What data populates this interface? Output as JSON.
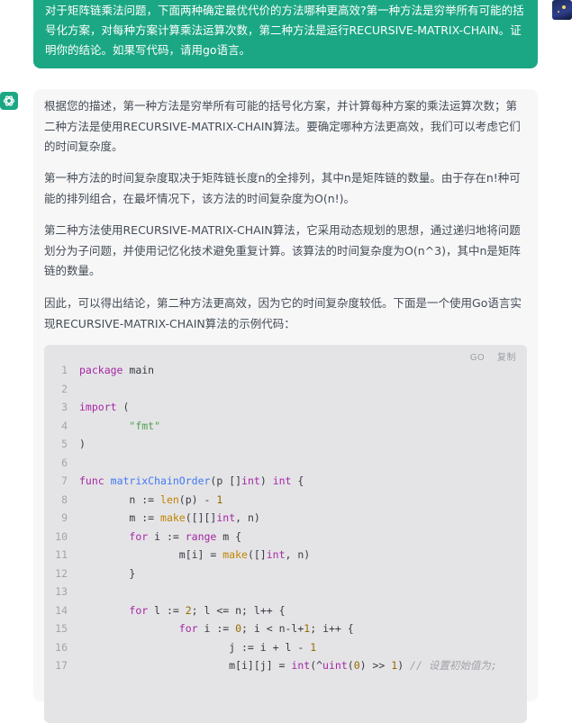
{
  "user_message": {
    "text": "对于矩阵链乘法问题，下面两种确定最优代价的方法哪种更高效?第一种方法是穷举所有可能的括号化方案，对每种方案计算乘法运算次数，第二种方法是运行RECURSIVE-MATRIX-CHAIN。证明你的结论。如果写代码，请用go语言。"
  },
  "assistant_message": {
    "paragraphs": [
      "根据您的描述，第一种方法是穷举所有可能的括号化方案，并计算每种方案的乘法运算次数；第二种方法是使用RECURSIVE-MATRIX-CHAIN算法。要确定哪种方法更高效，我们可以考虑它们的时间复杂度。",
      "第一种方法的时间复杂度取决于矩阵链长度n的全排列，其中n是矩阵链的数量。由于存在n!种可能的排列组合，在最坏情况下，该方法的时间复杂度为O(n!)。",
      "第二种方法使用RECURSIVE-MATRIX-CHAIN算法，它采用动态规划的思想，通过递归地将问题划分为子问题，并使用记忆化技术避免重复计算。该算法的时间复杂度为O(n^3)，其中n是矩阵链的数量。",
      "因此，可以得出结论，第二种方法更高效，因为它的时间复杂度较低。下面是一个使用Go语言实现RECURSIVE-MATRIX-CHAIN算法的示例代码："
    ]
  },
  "code_block": {
    "language": "GO",
    "copy_label": "复制",
    "lines": [
      {
        "n": "1",
        "text": "package main"
      },
      {
        "n": "2",
        "text": ""
      },
      {
        "n": "3",
        "text": "import ("
      },
      {
        "n": "4",
        "text": "        \"fmt\""
      },
      {
        "n": "5",
        "text": ")"
      },
      {
        "n": "6",
        "text": ""
      },
      {
        "n": "7",
        "text": "func matrixChainOrder(p []int) int {"
      },
      {
        "n": "8",
        "text": "        n := len(p) - 1"
      },
      {
        "n": "9",
        "text": "        m := make([][]int, n)"
      },
      {
        "n": "10",
        "text": "        for i := range m {"
      },
      {
        "n": "11",
        "text": "                m[i] = make([]int, n)"
      },
      {
        "n": "12",
        "text": "        }"
      },
      {
        "n": "13",
        "text": ""
      },
      {
        "n": "14",
        "text": "        for l := 2; l <= n; l++ {"
      },
      {
        "n": "15",
        "text": "                for i := 0; i < n-l+1; i++ {"
      },
      {
        "n": "16",
        "text": "                        j := i + l - 1"
      },
      {
        "n": "17",
        "text": "                        m[i][j] = int(^uint(0) >> 1) // 设置初始值为;"
      }
    ]
  },
  "colors": {
    "user_bubble": "#1ba784",
    "answer_bg": "#f7f7f8",
    "code_bg": "#e4e4e6"
  },
  "icons": {
    "user_avatar": "user-avatar-image",
    "bot_avatar": "chatgpt-logo-icon"
  }
}
